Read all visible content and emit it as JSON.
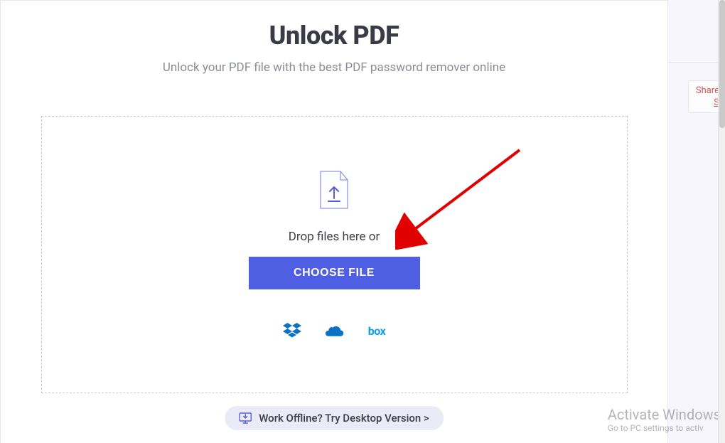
{
  "header": {
    "title": "Unlock PDF",
    "subtitle": "Unlock your PDF file with the best PDF password remover online"
  },
  "dropzone": {
    "drop_text": "Drop files here or",
    "choose_label": "CHOOSE FILE",
    "cloud_sources": {
      "dropbox": "dropbox",
      "onedrive": "onedrive",
      "box": "box"
    }
  },
  "desktop_cta": {
    "label": "Work Offline? Try Desktop Version >"
  },
  "share_tab": {
    "line1": "Share",
    "line2": "S"
  },
  "watermark": {
    "line1": "Activate Windows",
    "line2": "Go to PC settings to activ"
  },
  "colors": {
    "primary_button": "#4f5fe3",
    "arrow": "#e00000",
    "icon_outline": "#6b74e2",
    "cloud_blue": "#0a72c6",
    "box_blue": "#0ea0e9"
  }
}
